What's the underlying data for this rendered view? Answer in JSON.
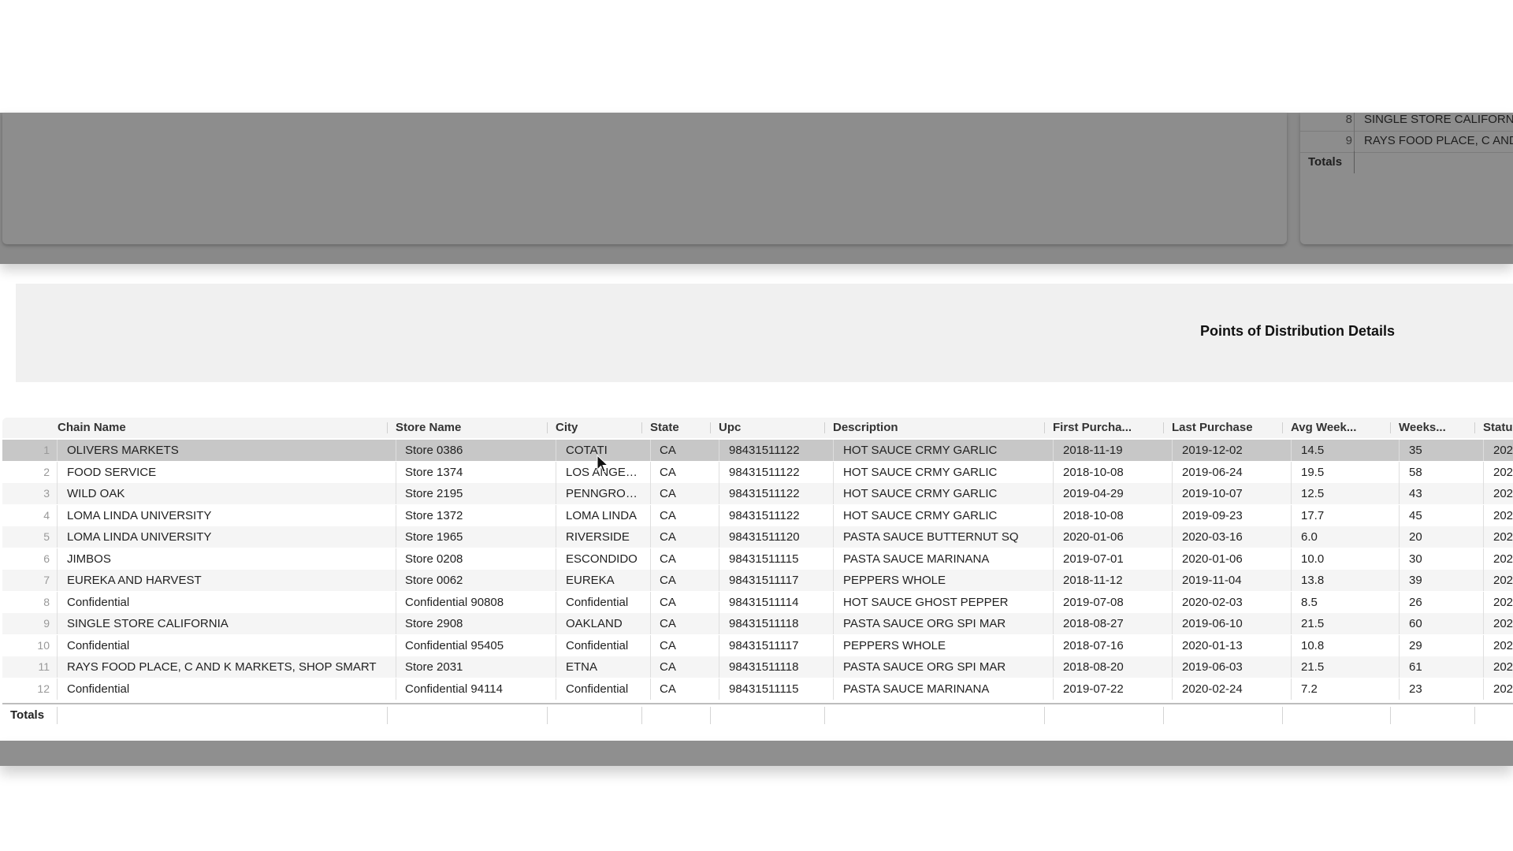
{
  "top_panel": {
    "mini_rows": [
      {
        "num": "8",
        "text": "SINGLE STORE CALIFORNI"
      },
      {
        "num": "9",
        "text": "RAYS FOOD PLACE, C AND"
      }
    ],
    "totals_label": "Totals"
  },
  "section": {
    "title": "Points of Distribution Details"
  },
  "table": {
    "columns": [
      "Chain Name",
      "Store Name",
      "City",
      "State",
      "Upc",
      "Description",
      "First Purcha...",
      "Last Purchase",
      "Avg Week...",
      "Weeks...",
      "Statu"
    ],
    "rows": [
      {
        "n": "1",
        "chain": "OLIVERS MARKETS",
        "store": "Store 0386",
        "city": "COTATI",
        "state": "CA",
        "upc": "98431511122",
        "desc": "HOT SAUCE CRMY GARLIC",
        "first": "2018-11-19",
        "last": "2019-12-02",
        "avg": "14.5",
        "weeks": "35",
        "status": "202"
      },
      {
        "n": "2",
        "chain": "FOOD SERVICE",
        "store": "Store 1374",
        "city": "LOS ANGEL...",
        "state": "CA",
        "upc": "98431511122",
        "desc": "HOT SAUCE CRMY GARLIC",
        "first": "2018-10-08",
        "last": "2019-06-24",
        "avg": "19.5",
        "weeks": "58",
        "status": "202"
      },
      {
        "n": "3",
        "chain": "WILD OAK",
        "store": "Store 2195",
        "city": "PENNGROVE",
        "state": "CA",
        "upc": "98431511122",
        "desc": "HOT SAUCE CRMY GARLIC",
        "first": "2019-04-29",
        "last": "2019-10-07",
        "avg": "12.5",
        "weeks": "43",
        "status": "202"
      },
      {
        "n": "4",
        "chain": "LOMA LINDA UNIVERSITY",
        "store": "Store 1372",
        "city": "LOMA LINDA",
        "state": "CA",
        "upc": "98431511122",
        "desc": "HOT SAUCE CRMY GARLIC",
        "first": "2018-10-08",
        "last": "2019-09-23",
        "avg": "17.7",
        "weeks": "45",
        "status": "202"
      },
      {
        "n": "5",
        "chain": "LOMA LINDA UNIVERSITY",
        "store": "Store 1965",
        "city": "RIVERSIDE",
        "state": "CA",
        "upc": "98431511120",
        "desc": "PASTA SAUCE BUTTERNUT SQ",
        "first": "2020-01-06",
        "last": "2020-03-16",
        "avg": "6.0",
        "weeks": "20",
        "status": "202"
      },
      {
        "n": "6",
        "chain": "JIMBOS",
        "store": "Store 0208",
        "city": "ESCONDIDO",
        "state": "CA",
        "upc": "98431511115",
        "desc": "PASTA SAUCE MARINANA",
        "first": "2019-07-01",
        "last": "2020-01-06",
        "avg": "10.0",
        "weeks": "30",
        "status": "202"
      },
      {
        "n": "7",
        "chain": "EUREKA AND HARVEST",
        "store": "Store 0062",
        "city": "EUREKA",
        "state": "CA",
        "upc": "98431511117",
        "desc": "PEPPERS WHOLE",
        "first": "2018-11-12",
        "last": "2019-11-04",
        "avg": "13.8",
        "weeks": "39",
        "status": "202"
      },
      {
        "n": "8",
        "chain": "Confidential",
        "store": "Confidential 90808",
        "city": "Confidential",
        "state": "CA",
        "upc": "98431511114",
        "desc": "HOT SAUCE GHOST PEPPER",
        "first": "2019-07-08",
        "last": "2020-02-03",
        "avg": "8.5",
        "weeks": "26",
        "status": "202"
      },
      {
        "n": "9",
        "chain": "SINGLE STORE CALIFORNIA",
        "store": "Store 2908",
        "city": "OAKLAND",
        "state": "CA",
        "upc": "98431511118",
        "desc": "PASTA SAUCE ORG SPI MAR",
        "first": "2018-08-27",
        "last": "2019-06-10",
        "avg": "21.5",
        "weeks": "60",
        "status": "202"
      },
      {
        "n": "10",
        "chain": "Confidential",
        "store": "Confidential 95405",
        "city": "Confidential",
        "state": "CA",
        "upc": "98431511117",
        "desc": "PEPPERS WHOLE",
        "first": "2018-07-16",
        "last": "2020-01-13",
        "avg": "10.8",
        "weeks": "29",
        "status": "202"
      },
      {
        "n": "11",
        "chain": "RAYS FOOD PLACE, C AND K MARKETS, SHOP SMART",
        "store": "Store 2031",
        "city": "ETNA",
        "state": "CA",
        "upc": "98431511118",
        "desc": "PASTA SAUCE ORG SPI MAR",
        "first": "2018-08-20",
        "last": "2019-06-03",
        "avg": "21.5",
        "weeks": "61",
        "status": "202"
      },
      {
        "n": "12",
        "chain": "Confidential",
        "store": "Confidential 94114",
        "city": "Confidential",
        "state": "CA",
        "upc": "98431511115",
        "desc": "PASTA SAUCE MARINANA",
        "first": "2019-07-22",
        "last": "2020-02-24",
        "avg": "7.2",
        "weeks": "23",
        "status": "202"
      }
    ],
    "selected_row": 1,
    "totals_label": "Totals"
  }
}
